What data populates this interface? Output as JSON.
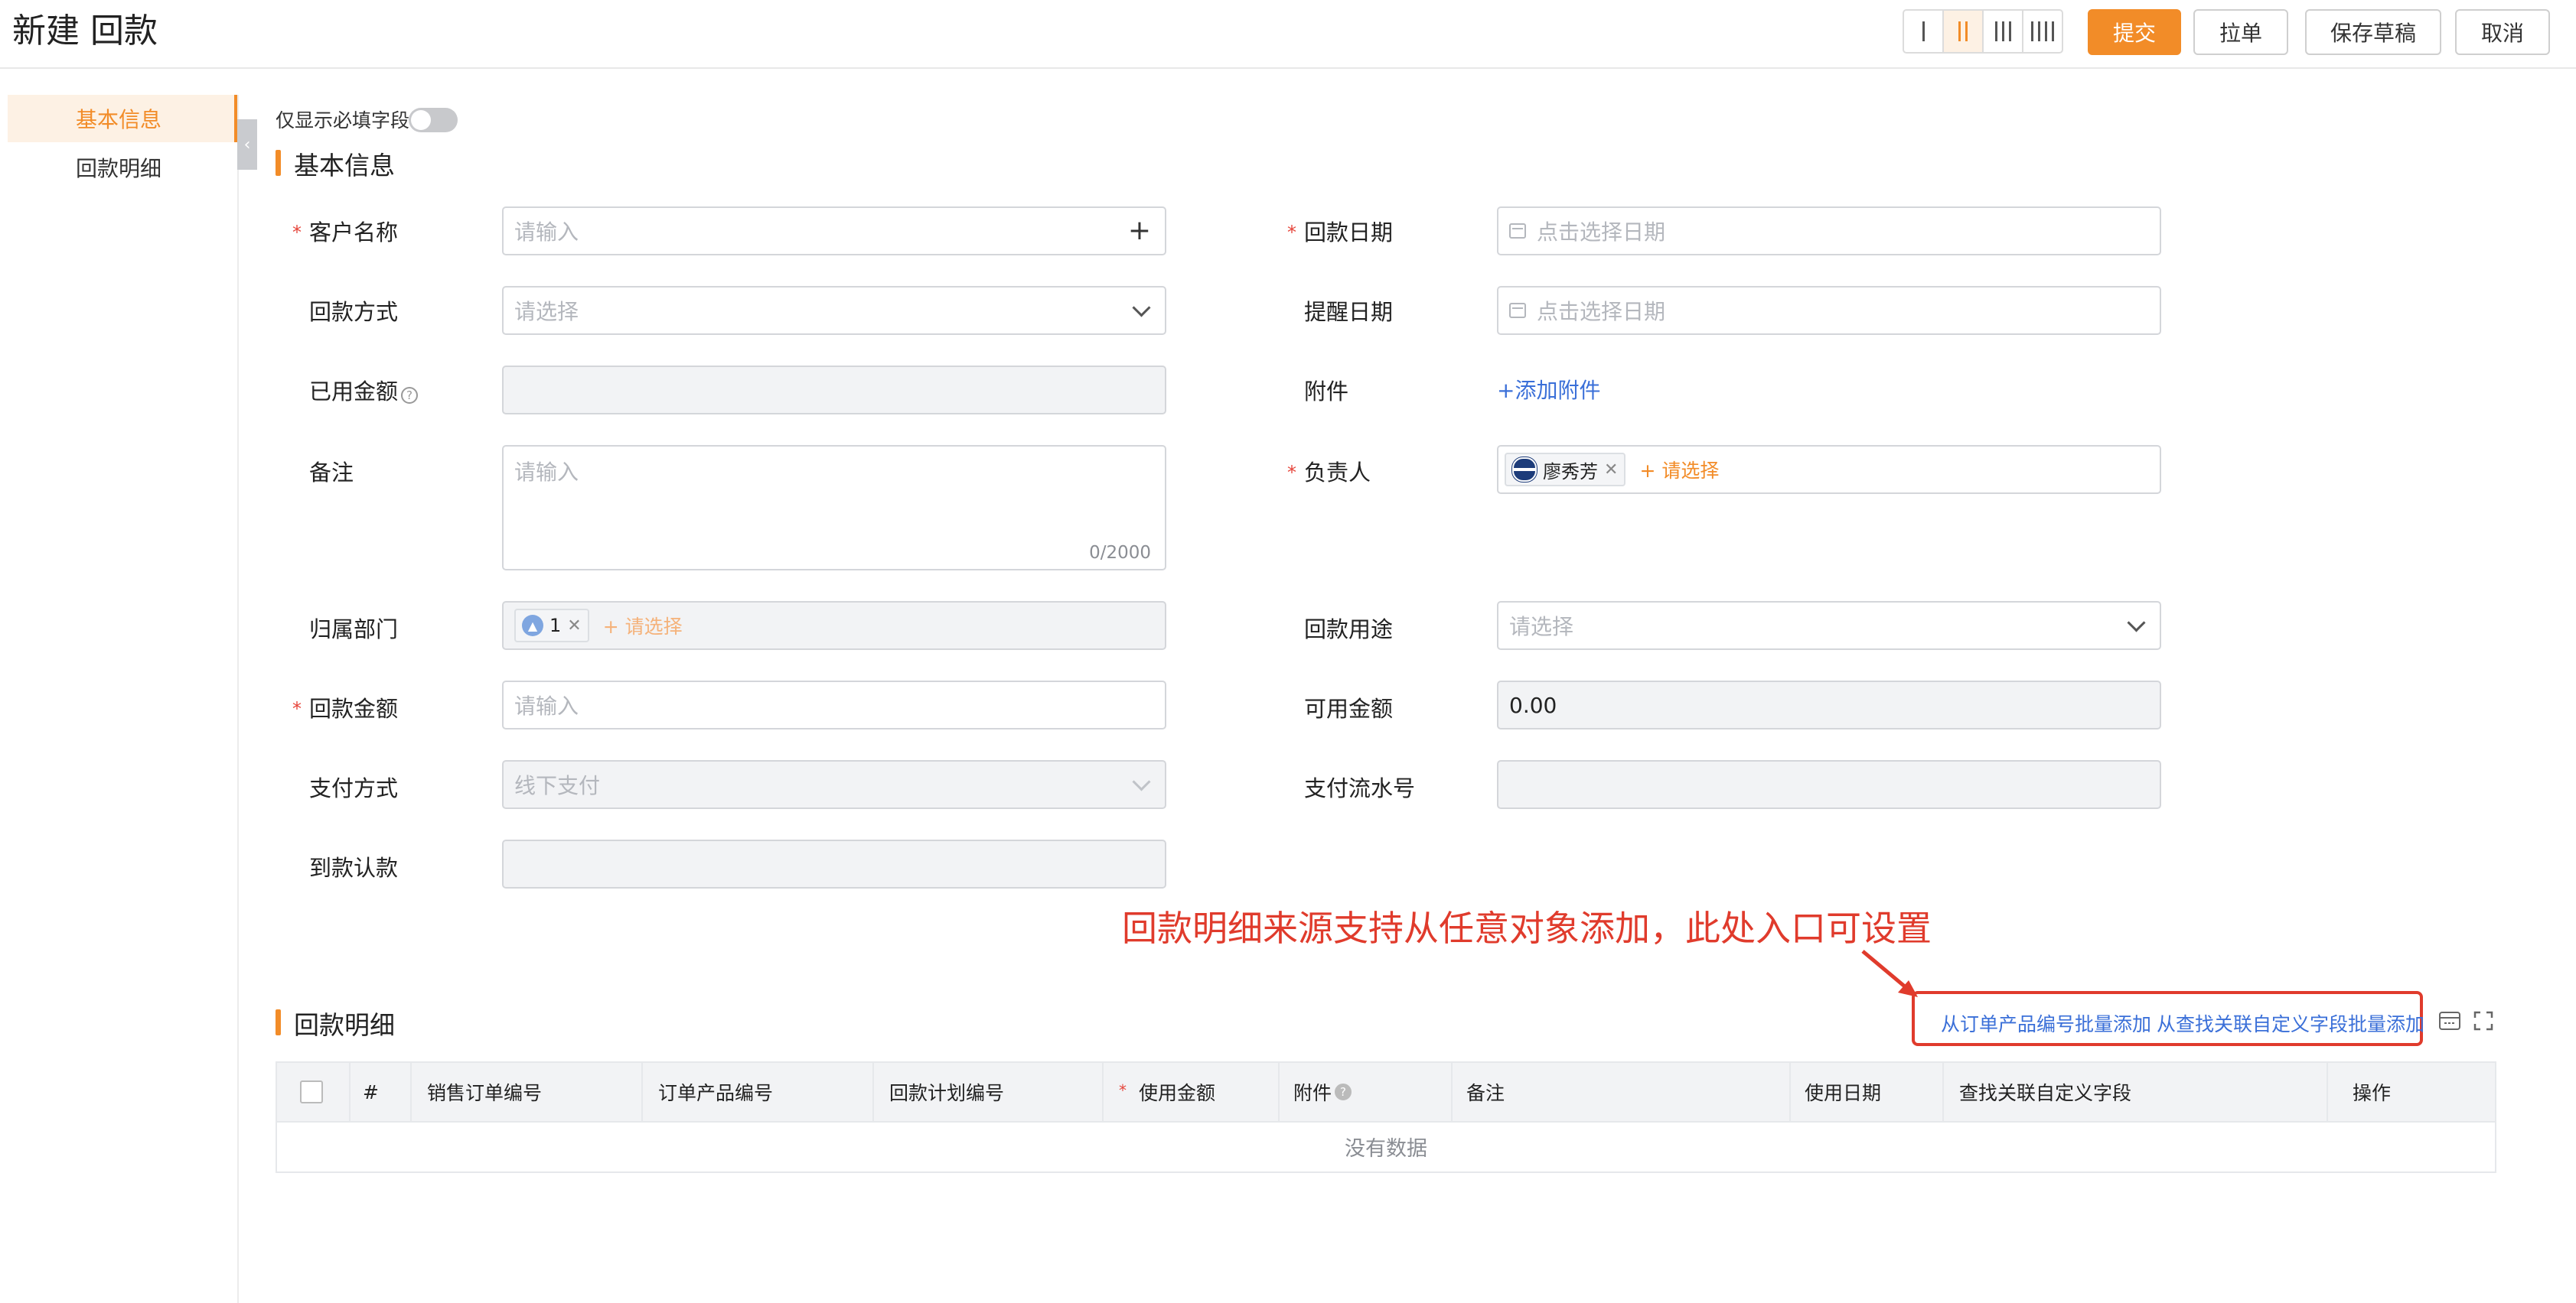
{
  "header": {
    "title": "新建 回款",
    "buttons": {
      "submit": "提交",
      "pull": "拉单",
      "save_draft": "保存草稿",
      "cancel": "取消"
    }
  },
  "sidebar": {
    "items": [
      {
        "label": "基本信息",
        "active": true
      },
      {
        "label": "回款明细",
        "active": false
      }
    ]
  },
  "toggle": {
    "label": "仅显示必填字段",
    "on": false
  },
  "section_basic": {
    "title": "基本信息"
  },
  "form": {
    "customer": {
      "label": "客户名称",
      "placeholder": "请输入",
      "required": true
    },
    "payment_method": {
      "label": "回款方式",
      "placeholder": "请选择"
    },
    "used_amount": {
      "label": "已用金额"
    },
    "remark": {
      "label": "备注",
      "placeholder": "请输入",
      "counter": "0/2000"
    },
    "department": {
      "label": "归属部门",
      "tag": "1",
      "add": "+ 请选择"
    },
    "amount": {
      "label": "回款金额",
      "placeholder": "请输入",
      "required": true
    },
    "pay_type": {
      "label": "支付方式",
      "value": "线下支付"
    },
    "arrival": {
      "label": "到款认款"
    },
    "payment_date": {
      "label": "回款日期",
      "placeholder": "点击选择日期",
      "required": true
    },
    "remind_date": {
      "label": "提醒日期",
      "placeholder": "点击选择日期"
    },
    "attachment": {
      "label": "附件",
      "action": "+添加附件"
    },
    "owner": {
      "label": "负责人",
      "tag": "廖秀芳",
      "add": "+ 请选择",
      "required": true
    },
    "purpose": {
      "label": "回款用途",
      "placeholder": "请选择"
    },
    "available": {
      "label": "可用金额",
      "value": "0.00"
    },
    "serial": {
      "label": "支付流水号"
    }
  },
  "annotation": "回款明细来源支持从任意对象添加，此处入口可设置",
  "section_detail": {
    "title": "回款明细",
    "batch_add_order": "从订单产品编号批量添加",
    "batch_add_custom": "从查找关联自定义字段批量添加"
  },
  "table": {
    "columns": [
      "#",
      "销售订单编号",
      "订单产品编号",
      "回款计划编号",
      "使用金额",
      "附件",
      "备注",
      "使用日期",
      "查找关联自定义字段",
      "操作"
    ],
    "empty_text": "没有数据"
  }
}
